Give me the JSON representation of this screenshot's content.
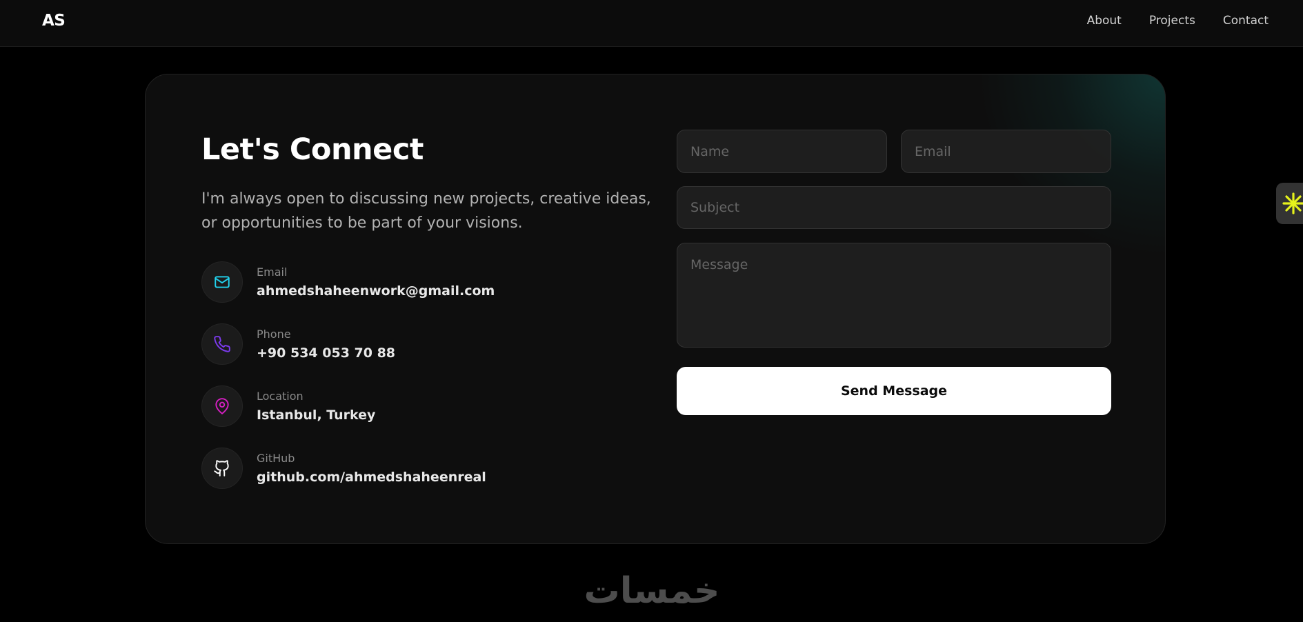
{
  "header": {
    "logo": "AS",
    "nav": [
      "About",
      "Projects",
      "Contact"
    ]
  },
  "contact": {
    "title": "Let's Connect",
    "intro": "I'm always open to discussing new projects, creative ideas, or opportunities to be part of your visions.",
    "items": [
      {
        "icon": "mail-icon",
        "label": "Email",
        "value": "ahmedshaheenwork@gmail.com",
        "color": "#22d3ee"
      },
      {
        "icon": "phone-icon",
        "label": "Phone",
        "value": "+90 534 053 70 88",
        "color": "#7c3aed"
      },
      {
        "icon": "map-pin-icon",
        "label": "Location",
        "value": "Istanbul, Turkey",
        "color": "#d61fc2"
      },
      {
        "icon": "github-icon",
        "label": "GitHub",
        "value": "github.com/ahmedshaheenreal",
        "color": "#ffffff"
      }
    ]
  },
  "form": {
    "name_placeholder": "Name",
    "email_placeholder": "Email",
    "subject_placeholder": "Subject",
    "message_placeholder": "Message",
    "submit_label": "Send Message"
  },
  "widgets": {
    "side_tab_icon": "asterisk-icon",
    "side_tab_color": "#e6f21c",
    "watermark": "خمسات"
  },
  "colors": {
    "background": "#000000",
    "card": "#0e0e0e",
    "card_glow": "#124e4a",
    "button": "#ffffff"
  }
}
